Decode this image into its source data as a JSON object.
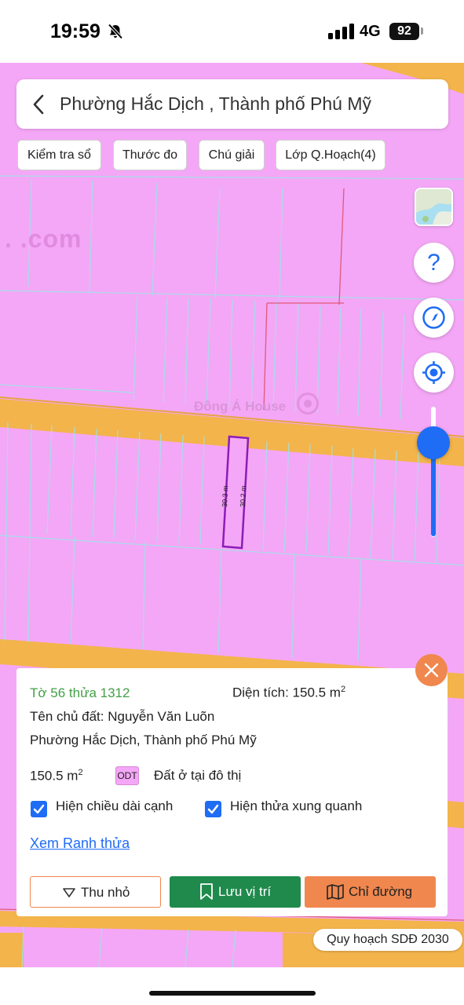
{
  "status_bar": {
    "time": "19:59",
    "network": "4G",
    "battery": "92"
  },
  "map": {
    "watermark_left": ". .com",
    "watermark_center": "Đông Á House",
    "plot": {
      "side_left": "30.3 m",
      "side_right": "30.2 m"
    },
    "colors": {
      "residential": "#f4a7f6",
      "road": "#f3b44b",
      "plot_outline": "#8c1cb8",
      "parcel_line": "#9ee3e8"
    }
  },
  "header": {
    "title": "Phường Hắc Dịch , Thành phố Phú Mỹ"
  },
  "chips": [
    {
      "label": "Kiểm tra sổ"
    },
    {
      "label": "Thước đo"
    },
    {
      "label": "Chú giải"
    },
    {
      "label": "Lớp Q.Hoạch(4)"
    }
  ],
  "controls": {
    "help_icon": "question-icon",
    "compass_icon": "compass-icon",
    "locate_icon": "locate-icon",
    "zoom_level": 0.75
  },
  "info": {
    "parcel": "Tờ 56 thửa 1312",
    "area_label": "Diện tích: 150.5 m",
    "area_unit_sup": "2",
    "owner": "Tên chủ đất: Nguyễn Văn Luõn",
    "address": "Phường Hắc Dịch, Thành phố Phú Mỹ",
    "land_area": "150.5 m",
    "land_area_sup": "2",
    "land_code": "ODT",
    "land_type": "Đất ở tại đô thị",
    "show_side_lengths": "Hiện chiều dài cạnh",
    "show_neighbors": "Hiện thửa xung quanh",
    "view_boundary": "Xem Ranh thửa",
    "btn_collapse": "Thu nhỏ",
    "btn_save": "Lưu vị trí",
    "btn_directions": "Chỉ đường",
    "colors": {
      "parcel_text": "#43a047",
      "save_btn": "#1f8a4c",
      "directions_btn": "#f0874e",
      "accent": "#1f6cf5"
    }
  },
  "plan_label": "Quy hoạch SDĐ 2030"
}
